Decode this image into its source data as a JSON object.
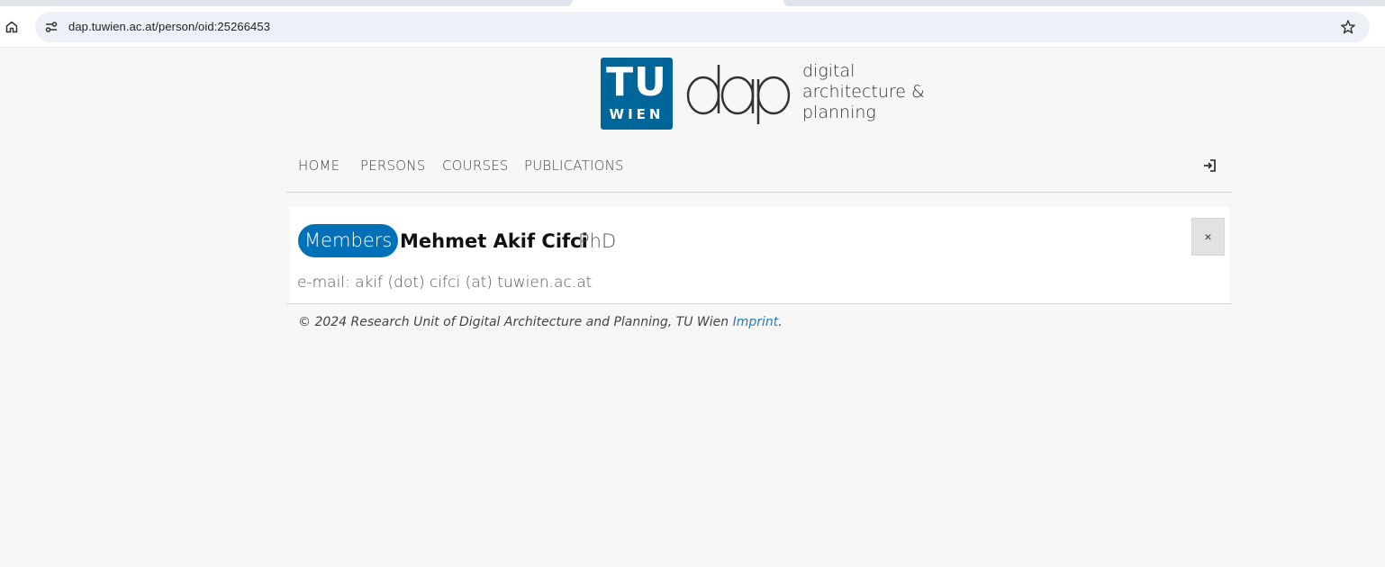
{
  "browser": {
    "url": "dap.tuwien.ac.at/person/oid:25266453",
    "icons": {
      "home": "home-icon",
      "site_info": "tune-icon",
      "bookmark": "star-icon"
    }
  },
  "header": {
    "logo_tu": "TU",
    "logo_wien": "WIEN",
    "dap_mark": "dap",
    "dap_sub_line1": "digital",
    "dap_sub_line2": "architecture &",
    "dap_sub_line3": "planning",
    "accent_color": "#006699"
  },
  "nav": {
    "items": [
      {
        "label": "HOME"
      },
      {
        "label": "PERSONS"
      },
      {
        "label": "COURSES"
      },
      {
        "label": "PUBLICATIONS"
      }
    ],
    "login_icon": "login-icon"
  },
  "person": {
    "badge": "Members",
    "name": "Mehmet Akif Cifci",
    "suffix": "PhD",
    "email": "e-mail: akif (dot) cifci (at) tuwien.ac.at",
    "close_label": "×",
    "badge_color": "#0071b9"
  },
  "footer": {
    "text": "© 2024 Research Unit of Digital Architecture and Planning, TU Wien ",
    "link": "Imprint",
    "after": "."
  }
}
